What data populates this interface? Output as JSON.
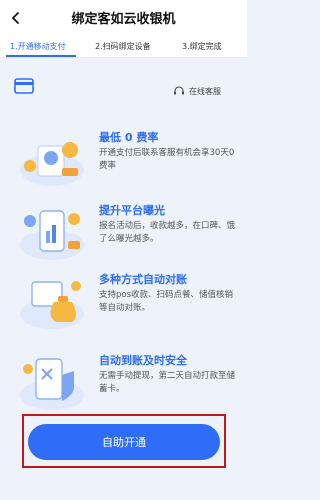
{
  "header": {
    "title": "绑定客如云收银机"
  },
  "steps": [
    {
      "label": "1.开通移动支付"
    },
    {
      "label": "2.扫码绑定设备"
    },
    {
      "label": "3.绑定完成"
    }
  ],
  "support": {
    "label": "在线客服"
  },
  "features": [
    {
      "title": "最低 0 费率",
      "desc": "开通支付后联系客服有机会享30天0费率"
    },
    {
      "title": "提升平台曝光",
      "desc": "报名活动后，收款越多，在口碑、饿了么曝光越多。"
    },
    {
      "title": "多种方式自动对账",
      "desc": "支持pos收款、扫码点餐、储值核销等自动对账。"
    },
    {
      "title": "自动到账及时安全",
      "desc": "无需手动提现，第二天自动打款至储蓄卡。"
    }
  ],
  "cta": {
    "label": "自助开通"
  },
  "colors": {
    "accent": "#2f6df6",
    "highlight_box": "#c0191d"
  }
}
